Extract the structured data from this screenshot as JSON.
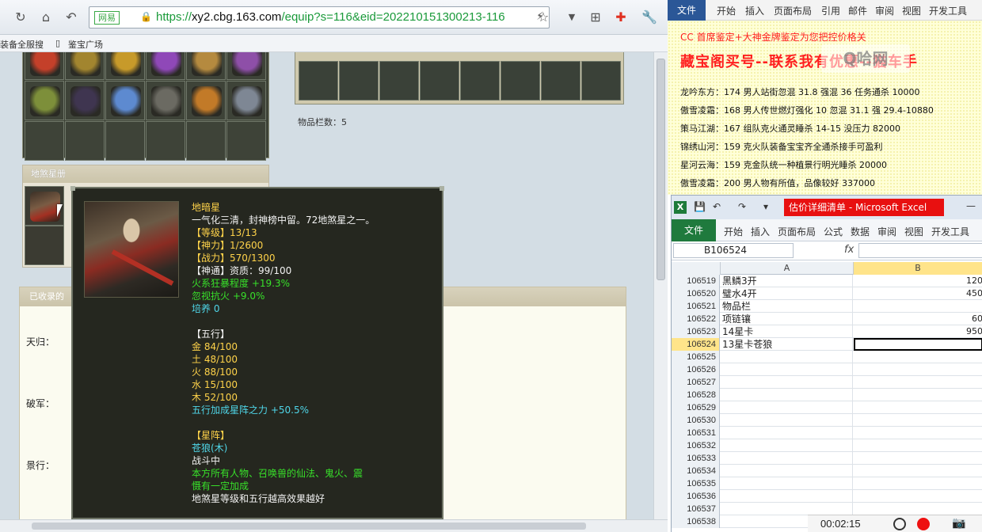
{
  "browser": {
    "site_label": "网易",
    "url_prefix": "https://",
    "url_domain": "xy2.cbg.163.com",
    "url_path": "/equip?s=116&eid=202210151300213-116",
    "bookmarks": [
      "装备全服搜",
      "鉴宝广场"
    ]
  },
  "page": {
    "items_count_label": "物品栏数：5",
    "star_panel_title": "地煞星册",
    "collected_title": "已收录的",
    "star_labels": [
      "天归：",
      "破军：",
      "景行："
    ],
    "item_colors": [
      "#c4402a",
      "#a2852f",
      "#c79a2a",
      "#8f48b8",
      "#b58a3f",
      "#8e4fa8",
      "#7d8f3a",
      "#3f3550",
      "#5d8ad0",
      "#6b6a62",
      "#c27a28",
      "#7e8794"
    ]
  },
  "tooltip": {
    "name": "地暗星",
    "desc": "一气化三清，封神榜中留。72地煞星之一。",
    "stats": [
      {
        "k": "【等级】",
        "v": "13/13"
      },
      {
        "k": "【神力】",
        "v": "1/2600"
      },
      {
        "k": "【战力】",
        "v": "570/1300"
      }
    ],
    "shentong": "【神通】资质：99/100",
    "bonus1": "火系狂暴程度 +19.3%",
    "bonus2": "忽视抗火 +9.0%",
    "training": "培养 0",
    "wuxing_title": "【五行】",
    "wuxing": [
      "金 84/100",
      "土 48/100",
      "火 88/100",
      "水 15/100",
      "木 52/100"
    ],
    "wuxing_bonus": "五行加成星阵之力 +50.5%",
    "xingzhen_title": "【星阵】",
    "xingzhen_name": "苍狼(木)",
    "xingzhen_state": "战斗中",
    "xingzhen_desc": "本方所有人物、召唤兽的仙法、鬼火、震慑有一定加成",
    "xingzhen_note": "地煞星等级和五行越高效果越好"
  },
  "word": {
    "file_tab": "文件",
    "tabs": [
      "开始",
      "插入",
      "页面布局",
      "引用",
      "邮件",
      "审阅",
      "视图",
      "开发工具"
    ],
    "red_small": "CC 首席鉴定+大神金牌鉴定为您把控价格关",
    "red_big": "藏宝阁买号--联系我有优惠--猫车手",
    "lines": [
      "龙吟东方：174 男人站街忽混 31.8 强混 36 任务通杀 10000",
      "傲雪凌霜：168 男人传世燃灯强化 10 忽混 31.1 强 29.4-10880",
      "策马江湖：167 组队克火通灵睡杀 14-15 没压力 82000",
      "锦绣山河：159 克火队装备宝宝齐全通杀接手可盈利",
      "星河云海：159 克金队统一种植景行明光睡杀 20000",
      "傲雪凌霜：200 男人物有所值，品像较好 337000"
    ],
    "watermark": "Q哈网"
  },
  "excel": {
    "title": "估价详细清单 - Microsoft Excel",
    "file_tab": "文件",
    "tabs": [
      "开始",
      "插入",
      "页面布局",
      "公式",
      "数据",
      "审阅",
      "视图",
      "开发工具"
    ],
    "name_box": "B106524",
    "fx": "fx",
    "col_a": "A",
    "col_b": "B",
    "rows": [
      {
        "n": "106519",
        "a": "黑鳞3开",
        "b": "120"
      },
      {
        "n": "106520",
        "a": "璧水4开",
        "b": "450"
      },
      {
        "n": "106521",
        "a": "物品栏",
        "b": ""
      },
      {
        "n": "106522",
        "a": "项链镶",
        "b": "60"
      },
      {
        "n": "106523",
        "a": "14星卡",
        "b": "950"
      },
      {
        "n": "106524",
        "a": "13星卡苍狼",
        "b": ""
      },
      {
        "n": "106525",
        "a": "",
        "b": ""
      },
      {
        "n": "106526",
        "a": "",
        "b": ""
      },
      {
        "n": "106527",
        "a": "",
        "b": ""
      },
      {
        "n": "106528",
        "a": "",
        "b": ""
      },
      {
        "n": "106529",
        "a": "",
        "b": ""
      },
      {
        "n": "106530",
        "a": "",
        "b": ""
      },
      {
        "n": "106531",
        "a": "",
        "b": ""
      },
      {
        "n": "106532",
        "a": "",
        "b": ""
      },
      {
        "n": "106533",
        "a": "",
        "b": ""
      },
      {
        "n": "106534",
        "a": "",
        "b": ""
      },
      {
        "n": "106535",
        "a": "",
        "b": ""
      },
      {
        "n": "106536",
        "a": "",
        "b": ""
      },
      {
        "n": "106537",
        "a": "",
        "b": ""
      },
      {
        "n": "106538",
        "a": "",
        "b": ""
      }
    ]
  },
  "recorder": {
    "time": "00:02:15"
  }
}
